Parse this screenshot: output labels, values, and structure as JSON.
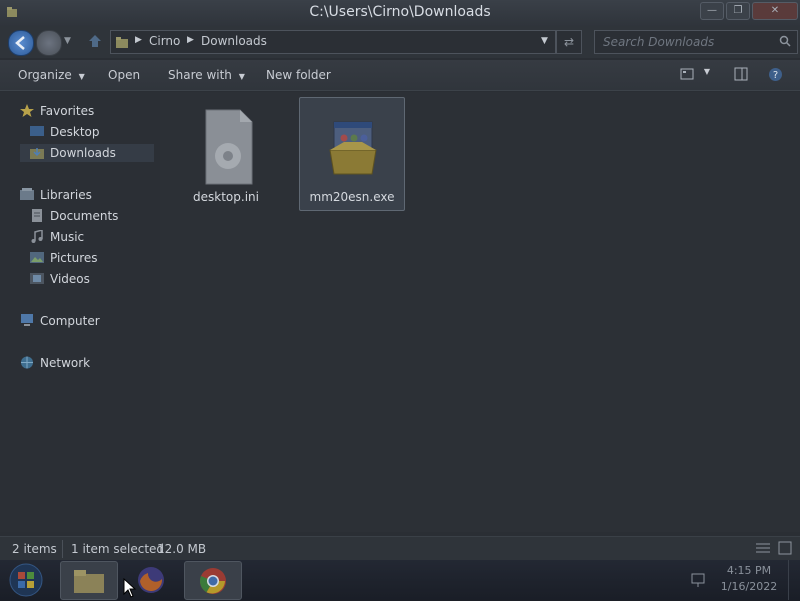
{
  "window": {
    "title": "C:\\Users\\Cirno\\Downloads",
    "minimize_icon": "minimize-icon",
    "restore_icon": "restore-icon",
    "close_icon": "close-icon"
  },
  "address": {
    "breadcrumbs": [
      "Cirno",
      "Downloads"
    ],
    "search_placeholder": "Search Downloads"
  },
  "toolbar": {
    "organize_label": "Organize",
    "open_label": "Open",
    "share_label": "Share with",
    "new_folder_label": "New folder"
  },
  "sidebar": {
    "favorites_label": "Favorites",
    "desktop_label": "Desktop",
    "downloads_label": "Downloads",
    "libraries_label": "Libraries",
    "documents_label": "Documents",
    "music_label": "Music",
    "pictures_label": "Pictures",
    "videos_label": "Videos",
    "computer_label": "Computer",
    "network_label": "Network"
  },
  "files": [
    {
      "name": "desktop.ini",
      "icon": "settings-file-icon",
      "selected": false
    },
    {
      "name": "mm20esn.exe",
      "icon": "installer-icon",
      "selected": true
    }
  ],
  "status": {
    "items_count": "2 items",
    "selection": "1 item selected",
    "size": "12.0 MB"
  },
  "taskbar": {
    "time": "4:15 PM",
    "date": "1/16/2022"
  },
  "colors": {
    "background": "#2a2e34",
    "accent": "#2d5b99"
  }
}
